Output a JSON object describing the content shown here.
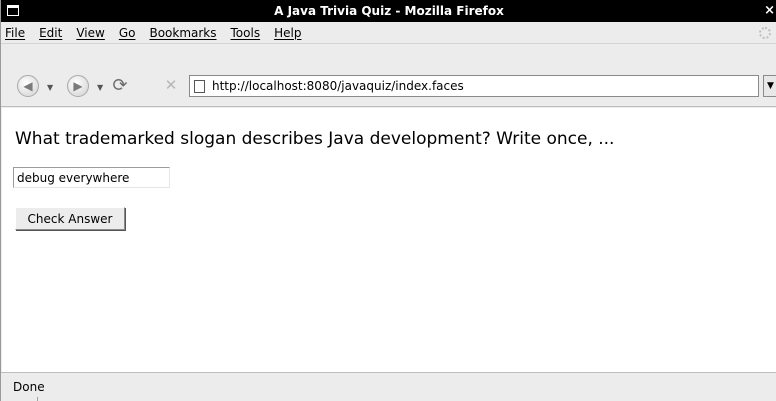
{
  "window": {
    "title": "A Java Trivia Quiz - Mozilla Firefox",
    "close_glyph": "×",
    "menu_icon": "window-menu-icon"
  },
  "menubar": {
    "items": [
      "File",
      "Edit",
      "View",
      "Go",
      "Bookmarks",
      "Tools",
      "Help"
    ]
  },
  "toolbar": {
    "back_icon": "back-arrow-icon",
    "forward_icon": "forward-arrow-icon",
    "reload_icon": "reload-icon",
    "stop_icon": "stop-icon",
    "url": "http://localhost:8080/javaquiz/index.faces"
  },
  "page": {
    "question": "What trademarked slogan describes Java development? Write once, ...",
    "answer_value": "debug everywhere",
    "check_button_label": "Check Answer"
  },
  "status": {
    "text": "Done"
  },
  "colors": {
    "titlebar_bg": "#000000",
    "chrome_bg": "#ececec",
    "content_bg": "#ffffff"
  }
}
